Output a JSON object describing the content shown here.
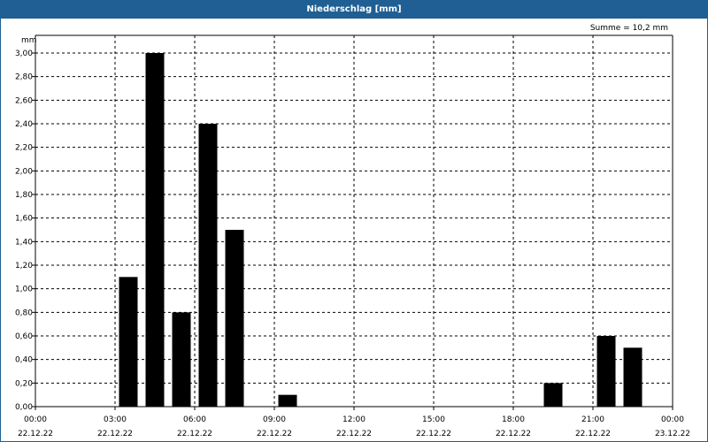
{
  "window": {
    "title": "Niederschlag [mm]"
  },
  "summary": "Summe = 10,2 mm",
  "colors": {
    "titlebar": "#1f5f93",
    "bar": "#000000",
    "grid": "#000000"
  },
  "chart_data": {
    "type": "bar",
    "title": "Niederschlag [mm]",
    "ylabel": "mm",
    "xlabel": "",
    "ylim": [
      0,
      3.0
    ],
    "xlim": [
      "22.12.22 00:00",
      "23.12.22 00:00"
    ],
    "grid": true,
    "yticks": [
      "0,00",
      "0,20",
      "0,40",
      "0,60",
      "0,80",
      "1,00",
      "1,20",
      "1,40",
      "1,60",
      "1,80",
      "2,00",
      "2,20",
      "2,40",
      "2,60",
      "2,80",
      "3,00"
    ],
    "xticks": [
      {
        "time": "00:00",
        "date": "22.12.22"
      },
      {
        "time": "03:00",
        "date": "22.12.22"
      },
      {
        "time": "06:00",
        "date": "22.12.22"
      },
      {
        "time": "09:00",
        "date": "22.12.22"
      },
      {
        "time": "12:00",
        "date": "22.12.22"
      },
      {
        "time": "15:00",
        "date": "22.12.22"
      },
      {
        "time": "18:00",
        "date": "22.12.22"
      },
      {
        "time": "21:00",
        "date": "22.12.22"
      },
      {
        "time": "00:00",
        "date": "23.12.22"
      }
    ],
    "bars": [
      {
        "time": "03:00",
        "value": 1.1
      },
      {
        "time": "04:00",
        "value": 3.0
      },
      {
        "time": "05:00",
        "value": 0.8
      },
      {
        "time": "06:00",
        "value": 2.4
      },
      {
        "time": "07:00",
        "value": 1.5
      },
      {
        "time": "09:00",
        "value": 0.1
      },
      {
        "time": "19:00",
        "value": 0.2
      },
      {
        "time": "21:00",
        "value": 0.6
      },
      {
        "time": "22:00",
        "value": 0.5
      }
    ]
  }
}
